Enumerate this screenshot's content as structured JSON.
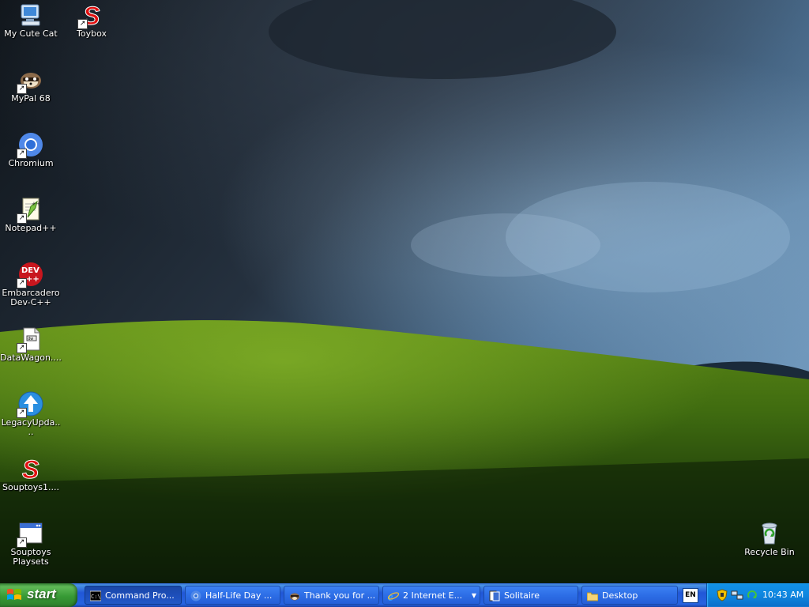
{
  "desktop": {
    "icons": [
      {
        "label": "My Cute Cat",
        "icon": "my-computer-icon"
      },
      {
        "label": "Toybox",
        "icon": "soup-s-icon"
      },
      {
        "label": "MyPal 68",
        "icon": "raccoon-icon"
      },
      {
        "label": "Chromium",
        "icon": "chromium-icon"
      },
      {
        "label": "Notepad++",
        "icon": "notepad-plus-icon"
      },
      {
        "label": "Embarcadero Dev-C++",
        "icon": "devcpp-icon"
      },
      {
        "label": "DataWagon....",
        "icon": "document-icon"
      },
      {
        "label": "LegacyUpda....",
        "icon": "update-arrow-icon"
      },
      {
        "label": "Souptoys1....",
        "icon": "soup-s-icon"
      },
      {
        "label": "Souptoys Playsets",
        "icon": "window-icon"
      },
      {
        "label": "Recycle Bin",
        "icon": "recycle-bin-icon"
      }
    ]
  },
  "taskbar": {
    "start_label": "start",
    "tasks": [
      {
        "label": "Command Pro...",
        "icon": "console-icon",
        "active": true
      },
      {
        "label": "Half-Life Day ...",
        "icon": "chromium-icon",
        "active": false
      },
      {
        "label": "Thank you for ...",
        "icon": "raccoon-icon",
        "active": false
      },
      {
        "label": "2 Internet E...",
        "icon": "internet-explorer-icon",
        "active": false
      },
      {
        "label": "Solitaire",
        "icon": "cards-icon",
        "active": false
      },
      {
        "label": "Desktop",
        "icon": "folder-icon",
        "active": false
      }
    ],
    "language": "EN",
    "clock": "10:43 AM"
  },
  "colors": {
    "taskbar_blue": "#2157d7",
    "start_green": "#379a35",
    "tray_blue": "#0f86df"
  }
}
